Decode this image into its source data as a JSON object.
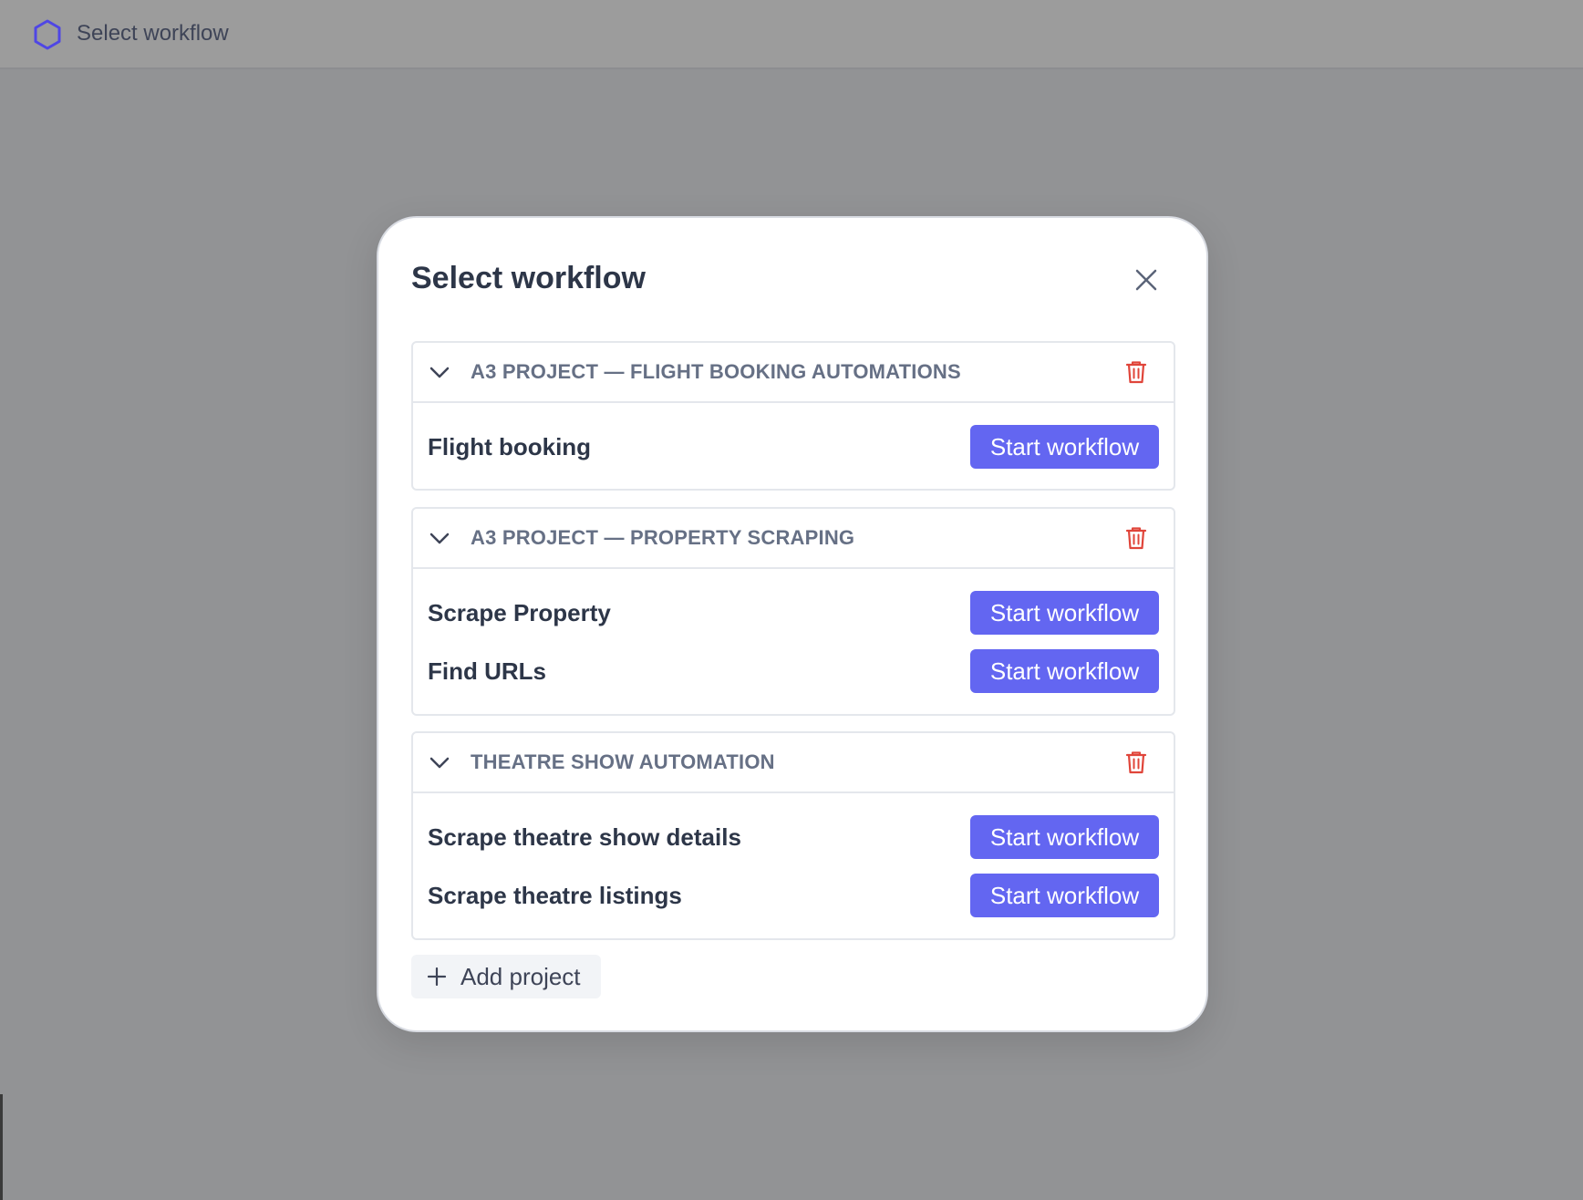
{
  "topbar": {
    "title": "Select workflow",
    "logo_icon": "hexagon-icon",
    "logo_color": "#4f46e5"
  },
  "modal": {
    "title": "Select workflow",
    "close_icon": "close-icon",
    "projects": [
      {
        "name": "A3 PROJECT — FLIGHT BOOKING AUTOMATIONS",
        "workflows": [
          {
            "name": "Flight booking",
            "button": "Start workflow"
          }
        ]
      },
      {
        "name": "A3 PROJECT — PROPERTY SCRAPING",
        "workflows": [
          {
            "name": "Scrape Property",
            "button": "Start workflow"
          },
          {
            "name": "Find URLs",
            "button": "Start workflow"
          }
        ]
      },
      {
        "name": "THEATRE SHOW AUTOMATION",
        "workflows": [
          {
            "name": "Scrape theatre show details",
            "button": "Start workflow"
          },
          {
            "name": "Scrape theatre listings",
            "button": "Start workflow"
          }
        ]
      }
    ],
    "add_project_label": "Add project"
  },
  "colors": {
    "accent": "#6366f1",
    "danger": "#e0453a",
    "overlay": "#929395"
  }
}
